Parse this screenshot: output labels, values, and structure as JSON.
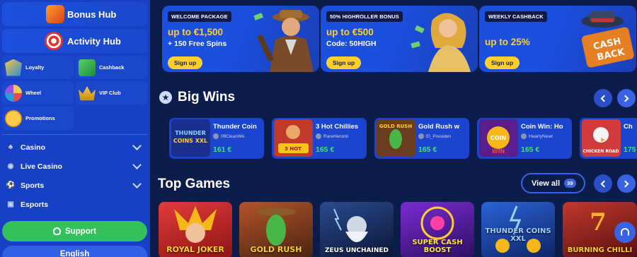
{
  "sidebar": {
    "hubs": [
      {
        "label": "Bonus Hub"
      },
      {
        "label": "Activity Hub"
      }
    ],
    "tiles": [
      {
        "label": "Loyalty"
      },
      {
        "label": "Cashback"
      },
      {
        "label": "Wheel"
      },
      {
        "label": "VIP Club"
      },
      {
        "label": "Promotions"
      }
    ],
    "nav": [
      {
        "label": "Casino"
      },
      {
        "label": "Live Casino"
      },
      {
        "label": "Sports"
      },
      {
        "label": "Esports"
      }
    ],
    "support_label": "Support",
    "language_label": "English"
  },
  "promos": [
    {
      "tag": "WELCOME PACKAGE",
      "line1": "up to €1,500",
      "line2": "+ 150 Free Spins",
      "button": "Sign up"
    },
    {
      "tag": "50% HIGHROLLER BONUS",
      "line1": "up to €500",
      "line2": "Code: 50HIGH",
      "button": "Sign up"
    },
    {
      "tag": "WEEKLY CASHBACK",
      "line1": "up to 25%",
      "line2": "",
      "button": "Sign up",
      "art_text": "CASH BACK"
    }
  ],
  "big_wins": {
    "title": "Big Wins",
    "items": [
      {
        "game": "Thunder Coin",
        "player": "0flCleanWe",
        "amount": "161 €",
        "thumb_text": "THUNDER COINS XXL"
      },
      {
        "game": "3 Hot Chillies",
        "player": "RareHeronti",
        "amount": "165 €",
        "thumb_text": "3 HOT CHILLIES"
      },
      {
        "game": "Gold Rush w",
        "player": "El_Presiden",
        "amount": "165 €",
        "thumb_text": "GOLD RUSH"
      },
      {
        "game": "Coin Win: Ho",
        "player": "HeartyNewt",
        "amount": "165 €",
        "thumb_text": "COIN WIN"
      },
      {
        "game": "Ch",
        "player": "",
        "amount": "175",
        "thumb_text": "CHICKEN ROAD"
      }
    ]
  },
  "top_games": {
    "title": "Top Games",
    "view_all_label": "View all",
    "view_all_count": "39",
    "items": [
      {
        "label": "ROYAL JOKER"
      },
      {
        "label": "GOLD RUSH"
      },
      {
        "label": "ZEUS UNCHAINED"
      },
      {
        "label": "SUPER CASH BOOST"
      },
      {
        "label": "THUNDER COINS XXL"
      },
      {
        "label": "BURNING CHILLI"
      }
    ]
  },
  "colors": {
    "sidebar": "#1840c4",
    "background": "#0d1d4b",
    "accent_yellow": "#ffd02b",
    "win_green": "#3ee07a",
    "support_green": "#34c05a"
  }
}
